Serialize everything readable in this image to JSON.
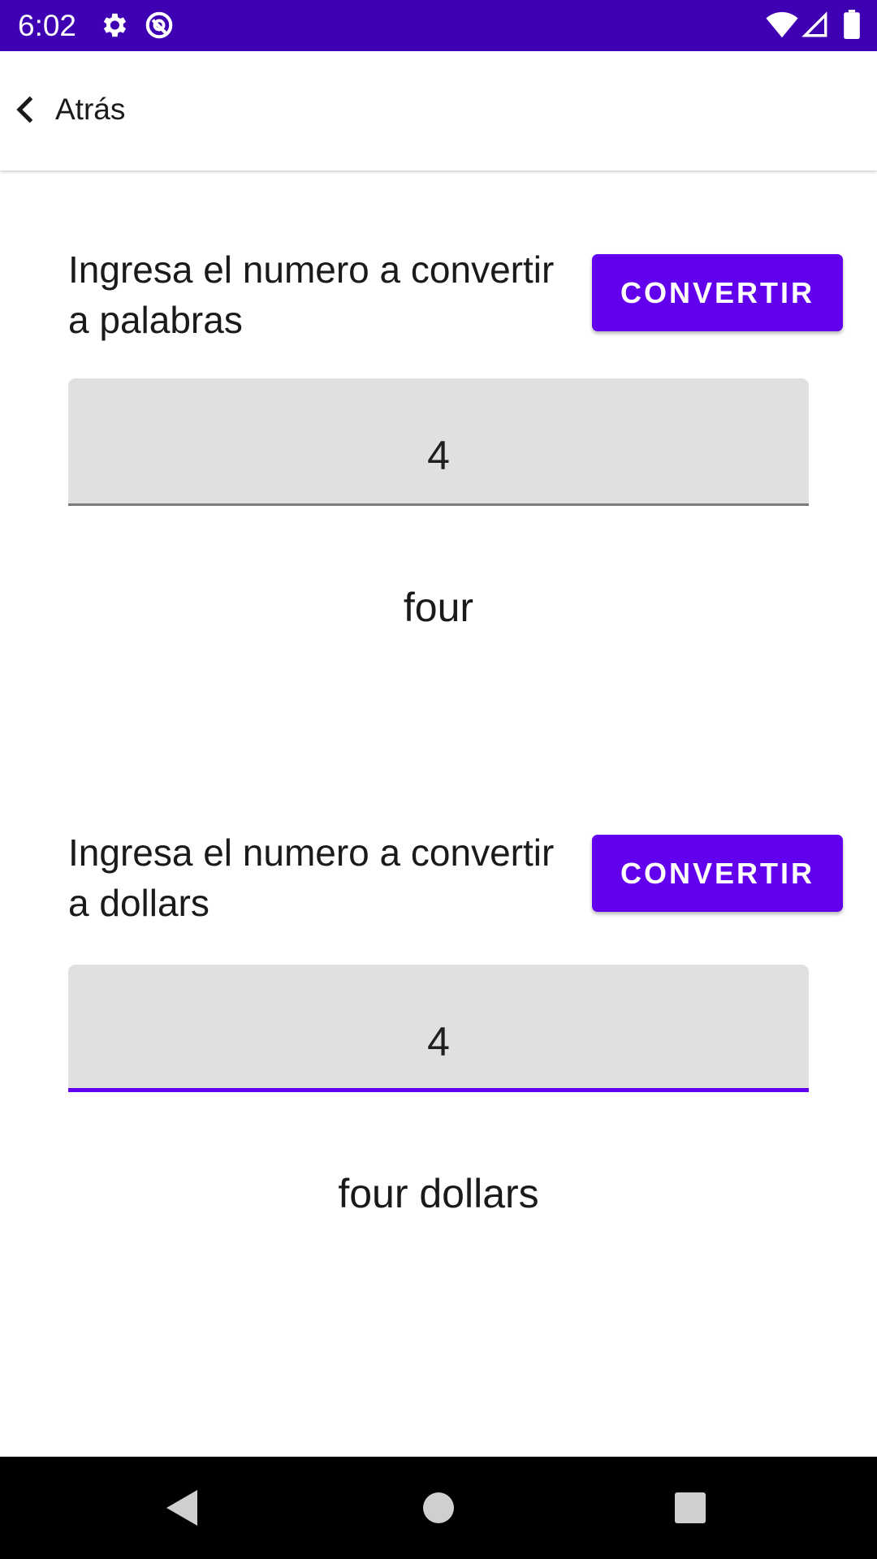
{
  "status_bar": {
    "time": "6:02",
    "icons": [
      "gear-icon",
      "vpn-icon",
      "wifi-icon",
      "signal-icon",
      "battery-icon"
    ],
    "background": "#3f00b4"
  },
  "app_bar": {
    "back_label": "Atrás",
    "back_icon": "chevron-left-icon"
  },
  "words_section": {
    "prompt": "Ingresa el numero a convertir a palabras",
    "button_label": "CONVERTIR",
    "input_value": "4",
    "result": "four"
  },
  "dollars_section": {
    "prompt": "Ingresa el numero a convertir a dollars",
    "button_label": "CONVERTIR",
    "input_value": "4",
    "result": "four dollars"
  },
  "nav_bar": {
    "buttons": [
      "back-triangle-icon",
      "home-circle-icon",
      "recents-square-icon"
    ]
  },
  "colors": {
    "accent": "#6200ee",
    "field_background": "#e0e0e0",
    "status_bar": "#3f00b4"
  }
}
